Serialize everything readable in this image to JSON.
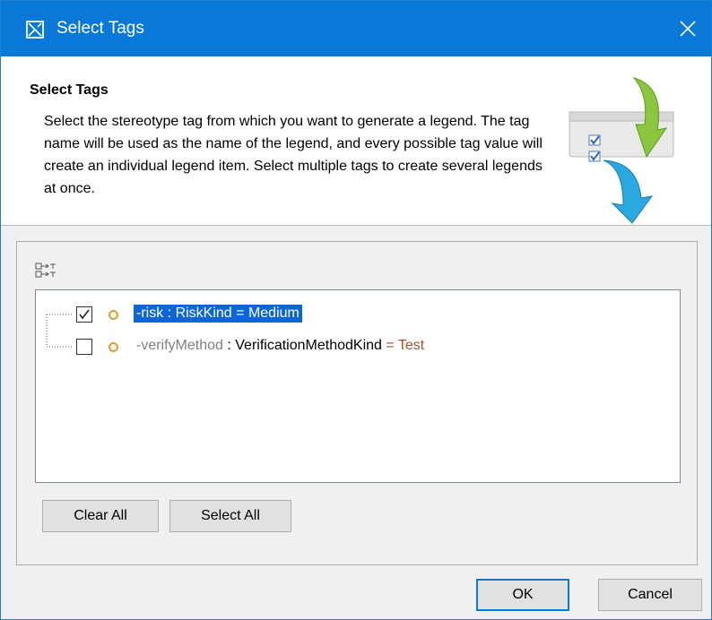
{
  "window": {
    "title": "Select Tags"
  },
  "header": {
    "title": "Select Tags",
    "description": "Select the stereotype tag from which you want to generate a legend. The tag name will be used as the name of the legend, and every possible tag value will create an individual legend item. Select multiple tags to create several legends at once."
  },
  "tags": [
    {
      "prefix": "-risk",
      "sep": " : ",
      "type": "RiskKind",
      "eq": " = ",
      "value": "Medium",
      "checked": true,
      "selected": true
    },
    {
      "prefix": "-verifyMethod",
      "sep": " : ",
      "type": "VerificationMethodKind",
      "eq": " = ",
      "value": "Test",
      "checked": false,
      "selected": false
    }
  ],
  "buttons": {
    "clear_all": "Clear All",
    "select_all": "Select All",
    "ok": "OK",
    "cancel": "Cancel"
  },
  "colors": {
    "title_bar": "#0a78d7",
    "selection": "#0c66d6",
    "value_text": "#a0522d",
    "prefix_text": "#808080"
  }
}
